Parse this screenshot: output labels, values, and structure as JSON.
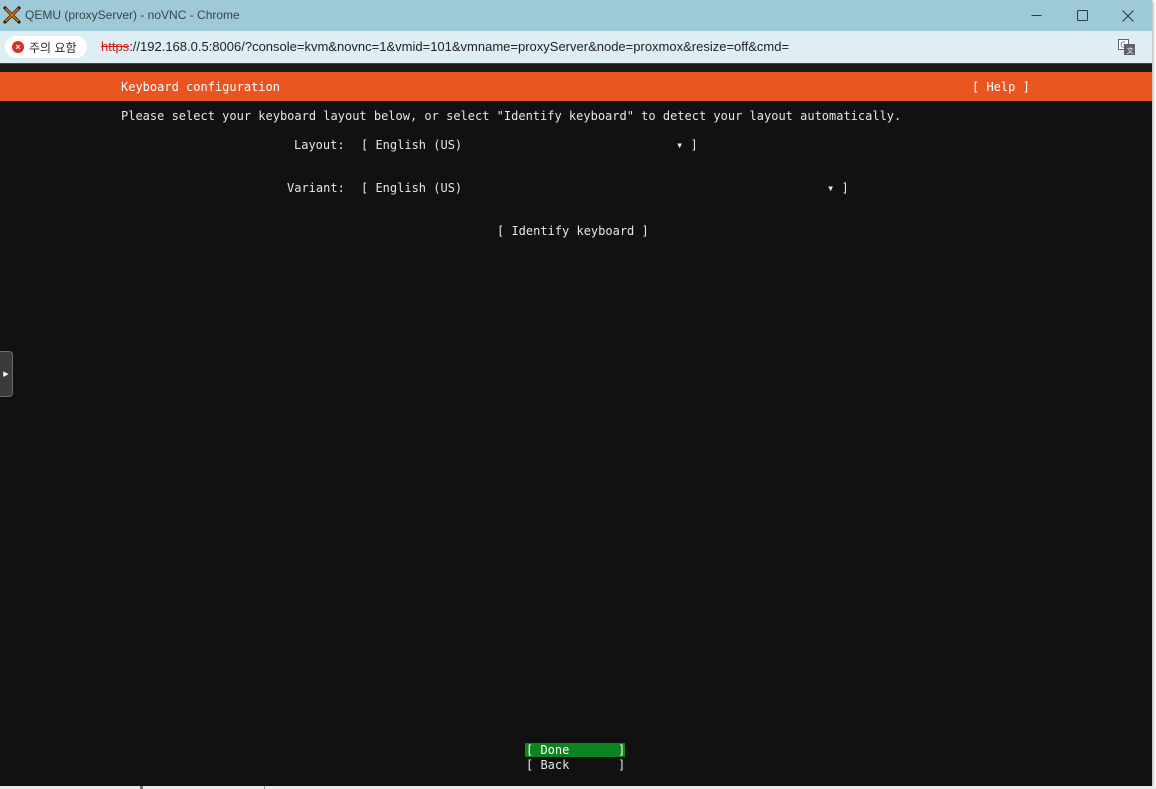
{
  "window": {
    "title": "QEMU (proxyServer) - noVNC - Chrome",
    "controls": {
      "minimize_icon": "minimize-icon",
      "maximize_icon": "maximize-icon",
      "close_icon": "close-icon"
    }
  },
  "addressbar": {
    "security_label": "주의 요함",
    "url_scheme": "https",
    "url_rest": "://192.168.0.5:8006/?console=kvm&novnc=1&vmid=101&vmname=proxyServer&node=proxmox&resize=off&cmd=",
    "translate_icon": "translate-icon"
  },
  "installer": {
    "header_title": "Keyboard configuration",
    "help_label": "[ Help ]",
    "instructions": "Please select your keyboard layout below, or select \"Identify keyboard\" to detect your layout automatically.",
    "layout": {
      "label": "Layout:",
      "value": "[ English (US)",
      "arrow": "▾ ]"
    },
    "variant": {
      "label": "Variant:",
      "value": "[ English (US)",
      "arrow": "▾ ]"
    },
    "identify_label": "[ Identify keyboard ]",
    "done": {
      "open": "[ Done",
      "close": "]"
    },
    "back": {
      "open": "[ Back",
      "close": "]"
    }
  },
  "colors": {
    "header": "#e95420",
    "done_highlight": "#0e8420",
    "terminal_bg": "#111111",
    "titlebar": "#9ecad7",
    "addressbar": "#dfeef3"
  }
}
